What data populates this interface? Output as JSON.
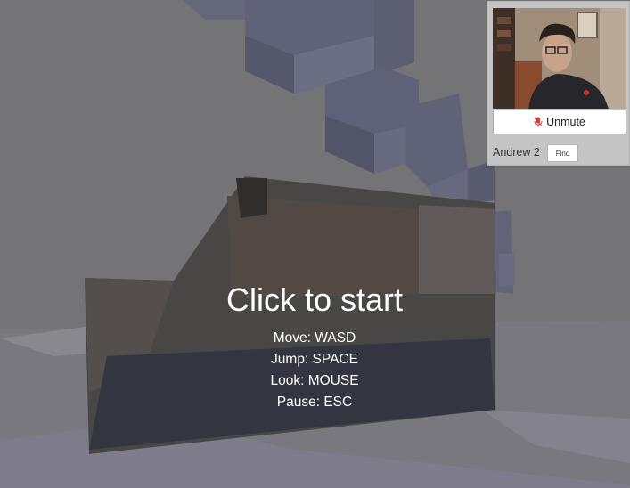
{
  "instructions": {
    "title": "Click to start",
    "controls": [
      "Move: WASD",
      "Jump: SPACE",
      "Look: MOUSE",
      "Pause: ESC"
    ]
  },
  "panel": {
    "unmute_label": "Unmute",
    "user_name": "Andrew 2",
    "find_label": "Find",
    "mic_icon": "mic-muted-icon"
  },
  "colors": {
    "sky": "#878787",
    "block": "#6e7088",
    "overlay_text": "#ffffff",
    "mute_icon": "#d93a3a"
  }
}
